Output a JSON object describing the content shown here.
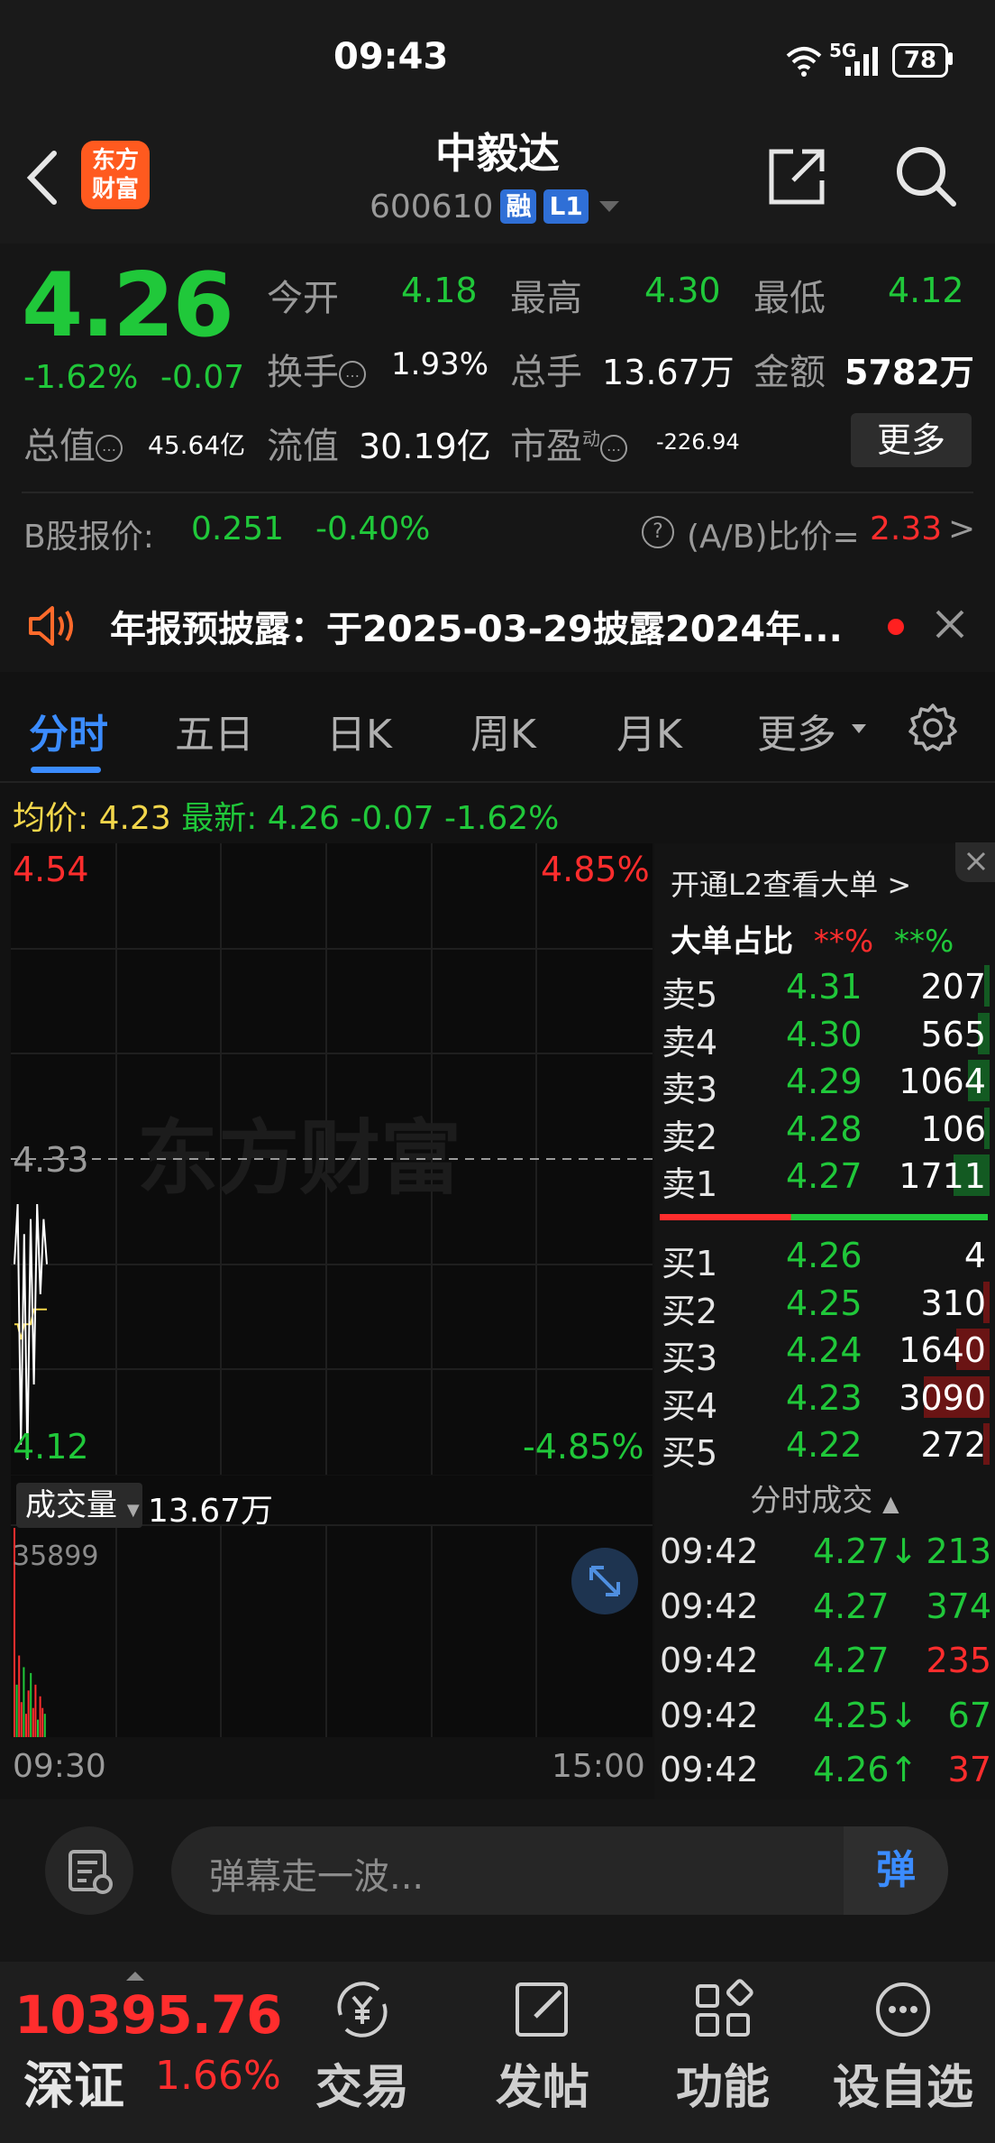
{
  "status_bar": {
    "time": "09:43",
    "battery": "78",
    "network": "5G"
  },
  "header": {
    "logo_line1": "东方",
    "logo_line2": "财富",
    "stock_name": "中毅达",
    "stock_code": "600610",
    "tag_margin": "融",
    "tag_level": "L1"
  },
  "quote": {
    "price": "4.26",
    "change_pct": "-1.62%",
    "change_val": "-0.07",
    "open_label": "今开",
    "open": "4.18",
    "high_label": "最高",
    "high": "4.30",
    "low_label": "最低",
    "low": "4.12",
    "turnover_label": "换手",
    "turnover": "1.93%",
    "volume_label": "总手",
    "volume": "13.67万",
    "amount_label": "金额",
    "amount": "5782万",
    "mktcap_label": "总值",
    "mktcap": "45.64亿",
    "float_label": "流值",
    "float_cap": "30.19亿",
    "pe_label": "市盈",
    "pe_sup": "动",
    "pe": "-226.94",
    "more_label": "更多"
  },
  "bshare": {
    "label": "B股报价:",
    "price": "0.251",
    "change": "-0.40%",
    "ab_label": "(A/B)比价=",
    "ab_value": "2.33",
    "ab_arrow": ">"
  },
  "notice": {
    "text": "年报预披露：于2025-03-29披露2024年..."
  },
  "tabs": [
    "分时",
    "五日",
    "日K",
    "周K",
    "月K",
    "更多"
  ],
  "avg": {
    "avg_label": "均价:",
    "avg_value": "4.23",
    "latest_label": "最新:",
    "latest_value": "4.26",
    "latest_chg": "-0.07",
    "latest_pct": "-1.62%"
  },
  "chart_data": {
    "type": "line",
    "title": "",
    "price_top": "4.54",
    "price_mid": "4.33",
    "price_bottom": "4.12",
    "pct_top": "4.85%",
    "pct_bottom": "-4.85%",
    "ylim": [
      4.12,
      4.54
    ],
    "reference": 4.33,
    "watermark": "东方财富",
    "series": [
      {
        "name": "最新",
        "values": [
          4.26,
          4.3,
          4.14,
          4.28,
          4.13,
          4.29,
          4.18,
          4.3,
          4.24,
          4.29,
          4.26
        ]
      },
      {
        "name": "均价",
        "values": [
          4.22,
          4.22,
          4.21,
          4.22,
          4.22,
          4.22,
          4.23,
          4.23,
          4.23,
          4.23,
          4.23
        ]
      }
    ],
    "volume": {
      "label": "成交量",
      "total": "13.67万",
      "max_label": "35899",
      "bars": [
        35899,
        9000,
        14000,
        6000,
        12000,
        4000,
        8000,
        11000,
        5000,
        9000,
        3000,
        7000,
        5000,
        4000
      ]
    },
    "time_start": "09:30",
    "time_end": "15:00"
  },
  "order_book": {
    "l2_link": "开通L2查看大单 >",
    "big_order_label": "大单占比",
    "big_order_red": "**%",
    "big_order_green": "**%",
    "asks": [
      {
        "label": "卖5",
        "price": "4.31",
        "vol": "207",
        "bar": 0.02
      },
      {
        "label": "卖4",
        "price": "4.30",
        "vol": "565",
        "bar": 0.06
      },
      {
        "label": "卖3",
        "price": "4.29",
        "vol": "1064",
        "bar": 0.11
      },
      {
        "label": "卖2",
        "price": "4.28",
        "vol": "106",
        "bar": 0.01
      },
      {
        "label": "卖1",
        "price": "4.27",
        "vol": "1711",
        "bar": 0.18
      }
    ],
    "bids": [
      {
        "label": "买1",
        "price": "4.26",
        "vol": "4",
        "bar": 0.0
      },
      {
        "label": "买2",
        "price": "4.25",
        "vol": "310",
        "bar": 0.03
      },
      {
        "label": "买3",
        "price": "4.24",
        "vol": "1640",
        "bar": 0.17
      },
      {
        "label": "买4",
        "price": "4.23",
        "vol": "3090",
        "bar": 0.33
      },
      {
        "label": "买5",
        "price": "4.22",
        "vol": "272",
        "bar": 0.03
      }
    ],
    "ticks_header": "分时成交",
    "ticks": [
      {
        "time": "09:42",
        "price": "4.27↓",
        "vol": "213",
        "vol_color": "green"
      },
      {
        "time": "09:42",
        "price": "4.27",
        "vol": "374",
        "vol_color": "green"
      },
      {
        "time": "09:42",
        "price": "4.27",
        "vol": "235",
        "vol_color": "red"
      },
      {
        "time": "09:42",
        "price": "4.25↓",
        "vol": "67",
        "vol_color": "green"
      },
      {
        "time": "09:42",
        "price": "4.26↑",
        "vol": "37",
        "vol_color": "red"
      }
    ]
  },
  "comment": {
    "placeholder": "弹幕走一波...",
    "danmu_label": "弹"
  },
  "bottom_nav": {
    "index_value": "10395.76",
    "index_name": "深证",
    "index_pct": "1.66%",
    "items": [
      "交易",
      "发帖",
      "功能",
      "设自选"
    ]
  },
  "colors": {
    "up": "#ff2d2d",
    "down": "#20c83a",
    "accent": "#3b8cff",
    "avg": "#f2d64b"
  }
}
